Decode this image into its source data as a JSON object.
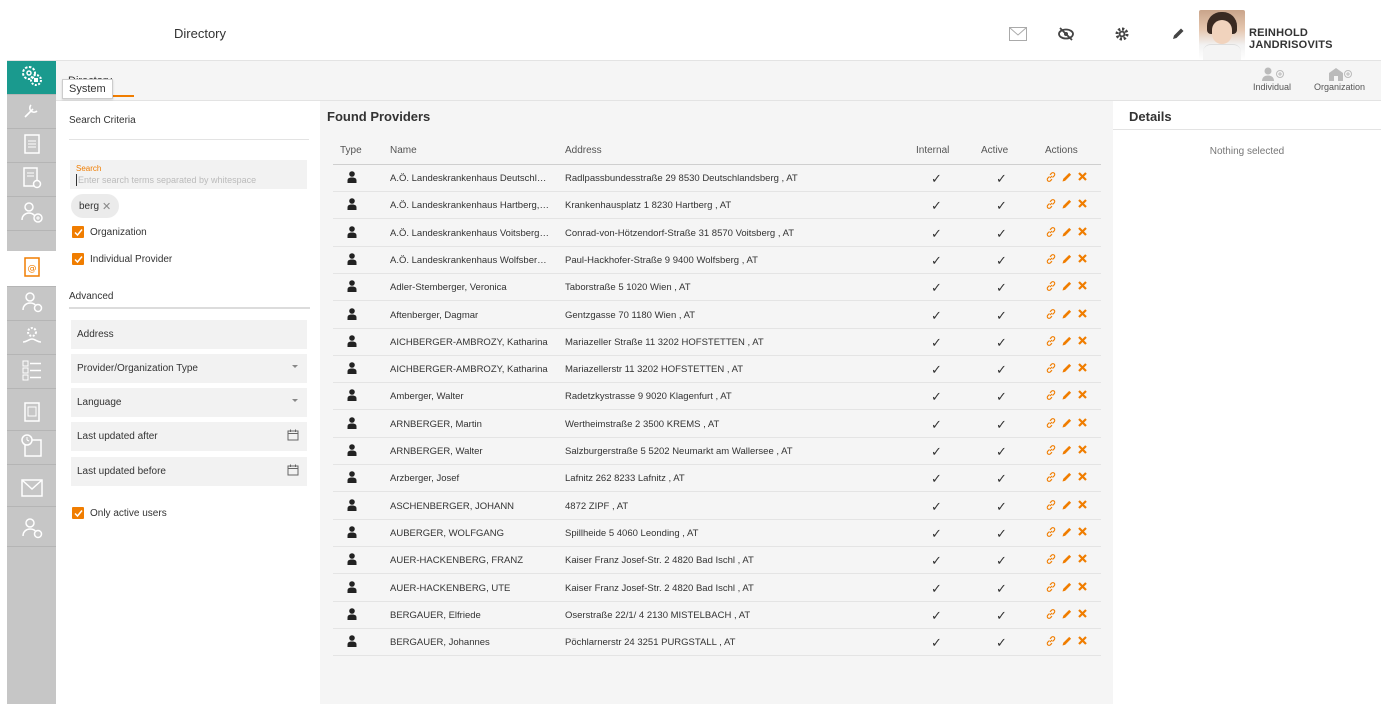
{
  "header": {
    "title": "Directory",
    "user_name": "REINHOLD JANDRISOVITS"
  },
  "subbar": {
    "tab_label": "Directory",
    "tooltip": "System",
    "add_individual": "Individual",
    "add_organization": "Organization"
  },
  "criteria": {
    "header": "Search Criteria",
    "search_label": "Search",
    "search_placeholder": "Enter search terms separated by whitespace",
    "chip": "berg",
    "organization_label": "Organization",
    "individual_label": "Individual Provider",
    "advanced_label": "Advanced",
    "address_label": "Address",
    "type_label": "Provider/Organization Type",
    "language_label": "Language",
    "updated_after_label": "Last updated after",
    "updated_before_label": "Last updated before",
    "only_active_label": "Only active users"
  },
  "providers": {
    "title": "Found Providers",
    "columns": {
      "type": "Type",
      "name": "Name",
      "address": "Address",
      "internal": "Internal",
      "active": "Active",
      "actions": "Actions"
    },
    "rows": [
      {
        "name": "A.Ö. Landeskrankenhaus Deutschlan...",
        "address": "Radlpassbundesstraße 29 8530 Deutschlandsberg , AT"
      },
      {
        "name": "A.Ö. Landeskrankenhaus Hartberg, null",
        "address": "Krankenhausplatz 1 8230 Hartberg , AT"
      },
      {
        "name": "A.Ö. Landeskrankenhaus Voitsberg, n...",
        "address": "Conrad-von-Hötzendorf-Straße 31 8570 Voitsberg , AT"
      },
      {
        "name": "A.Ö. Landeskrankenhaus Wolfsberg, ...",
        "address": "Paul-Hackhofer-Straße 9 9400 Wolfsberg , AT"
      },
      {
        "name": "Adler-Stemberger, Veronica",
        "address": "Taborstraße 5 1020 Wien , AT"
      },
      {
        "name": "Aftenberger, Dagmar",
        "address": "Gentzgasse 70 1180 Wien , AT"
      },
      {
        "name": "AICHBERGER-AMBROZY, Katharina",
        "address": "Mariazeller Straße 11 3202 HOFSTETTEN , AT"
      },
      {
        "name": "AICHBERGER-AMBROZY, Katharina",
        "address": "Mariazellerstr 11 3202 HOFSTETTEN , AT"
      },
      {
        "name": "Amberger, Walter",
        "address": "Radetzkystrasse 9 9020 Klagenfurt , AT"
      },
      {
        "name": "ARNBERGER, Martin",
        "address": "Wertheimstraße 2 3500 KREMS , AT"
      },
      {
        "name": "ARNBERGER, Walter",
        "address": "Salzburgerstraße 5 5202 Neumarkt am Wallersee , AT"
      },
      {
        "name": "Arzberger, Josef",
        "address": "Lafnitz 262 8233 Lafnitz , AT"
      },
      {
        "name": "ASCHENBERGER, JOHANN",
        "address": "4872 ZIPF , AT"
      },
      {
        "name": "AUBERGER, WOLFGANG",
        "address": "Spillheide 5 4060 Leonding , AT"
      },
      {
        "name": "AUER-HACKENBERG, FRANZ",
        "address": "Kaiser Franz Josef-Str. 2 4820 Bad Ischl , AT"
      },
      {
        "name": "AUER-HACKENBERG, UTE",
        "address": "Kaiser Franz Josef-Str. 2 4820 Bad Ischl , AT"
      },
      {
        "name": "BERGAUER, Elfriede",
        "address": "Oserstraße 22/1/ 4 2130 MISTELBACH , AT"
      },
      {
        "name": "BERGAUER, Johannes",
        "address": "Pöchlarnerstr 24 3251 PURGSTALL , AT"
      }
    ],
    "check": "✓"
  },
  "details": {
    "title": "Details",
    "empty": "Nothing selected"
  },
  "colors": {
    "accent": "#f07d00",
    "teal": "#1a9a8e",
    "nav_bg": "#c6c6c6"
  }
}
